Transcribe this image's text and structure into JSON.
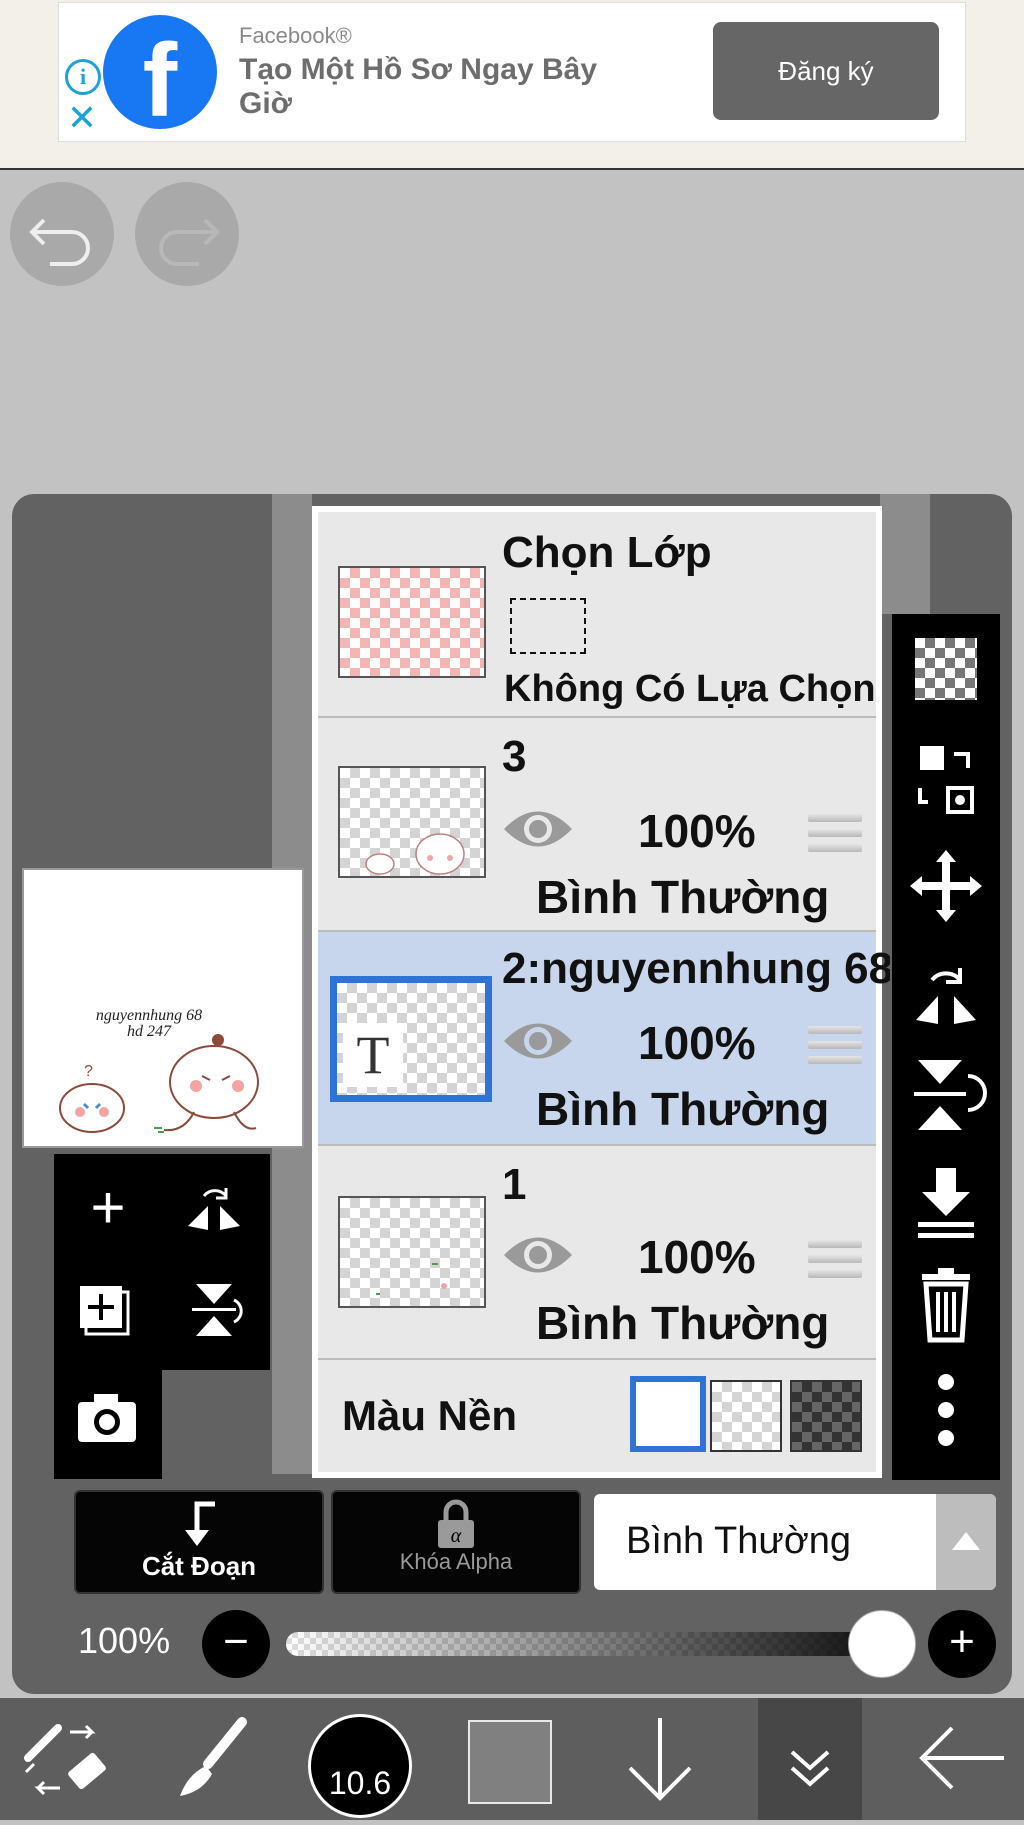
{
  "ad": {
    "brand": "Facebook®",
    "headline": "Tạo Một Hồ Sơ Ngay Bây Giờ",
    "cta": "Đăng ký",
    "logo_letter": "f"
  },
  "canvas_preview": {
    "watermark_line1": "nguyennhung 68",
    "watermark_line2": "hd 247"
  },
  "layers": {
    "selection_layer": {
      "title": "Chọn Lớp",
      "status": "Không Có Lựa Chọn"
    },
    "items": [
      {
        "name": "3",
        "opacity": "100%",
        "blend": "Bình Thường",
        "visible": true,
        "selected": false
      },
      {
        "name": "2:nguyennhung 68",
        "opacity": "100%",
        "blend": "Bình Thường",
        "visible": true,
        "selected": true,
        "thumb_letter": "T"
      },
      {
        "name": "1",
        "opacity": "100%",
        "blend": "Bình Thường",
        "visible": true,
        "selected": false
      }
    ],
    "background_label": "Màu Nền"
  },
  "controls": {
    "clipping_label": "Cắt Đoạn",
    "alpha_lock_label": "Khóa Alpha",
    "blend_mode": "Bình Thường",
    "opacity_label": "100%",
    "opacity_value": 1.0
  },
  "bottom_nav": {
    "brush_size": "10.6"
  },
  "colors": {
    "selected_row": "#c7d6ec",
    "selected_outline": "#2f73d8",
    "facebook_blue": "#1877f2"
  }
}
